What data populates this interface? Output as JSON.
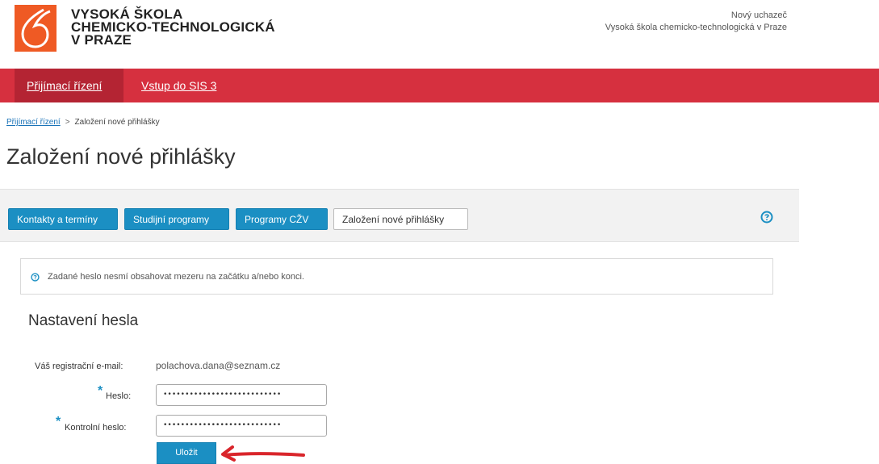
{
  "header": {
    "school_name": [
      "VYSOKÁ ŠKOLA",
      "CHEMICKO-TECHNOLOGICKÁ",
      "V PRAZE"
    ],
    "user_role": "Nový uchazeč",
    "user_school": "Vysoká škola chemicko-technologická v Praze",
    "logo_color": "#ef5a24"
  },
  "nav": {
    "items": [
      {
        "label": "Přijímací řízení",
        "active": true
      },
      {
        "label": "Vstup do SIS 3",
        "active": false
      }
    ],
    "bar_color": "#d6303f"
  },
  "breadcrumb": {
    "link": "Přijímací řízení",
    "separator": ">",
    "current": "Založení nové přihlášky"
  },
  "page_title": "Založení nové přihlášky",
  "tabs": [
    {
      "label": "Kontakty a termíny"
    },
    {
      "label": "Studijní programy"
    },
    {
      "label": "Programy CŽV"
    },
    {
      "label": "Založení nové přihlášky",
      "selected": true
    }
  ],
  "alert": {
    "icon": "info-circle-icon",
    "text": "Zadané heslo nesmí obsahovat mezeru na začátku a/nebo konci."
  },
  "form": {
    "section_title": "Nastavení hesla",
    "email_label": "Váš registrační e-mail:",
    "email_value": "polachova.dana@seznam.cz",
    "required_marker": "*",
    "password_label": "Heslo:",
    "password_value": "•••••••••••••••••••••••••••",
    "confirm_label": "Kontrolní heslo:",
    "confirm_value": "•••••••••••••••••••••••••••",
    "save_label": "Uložit"
  },
  "accent_color": "#1b8fc3"
}
